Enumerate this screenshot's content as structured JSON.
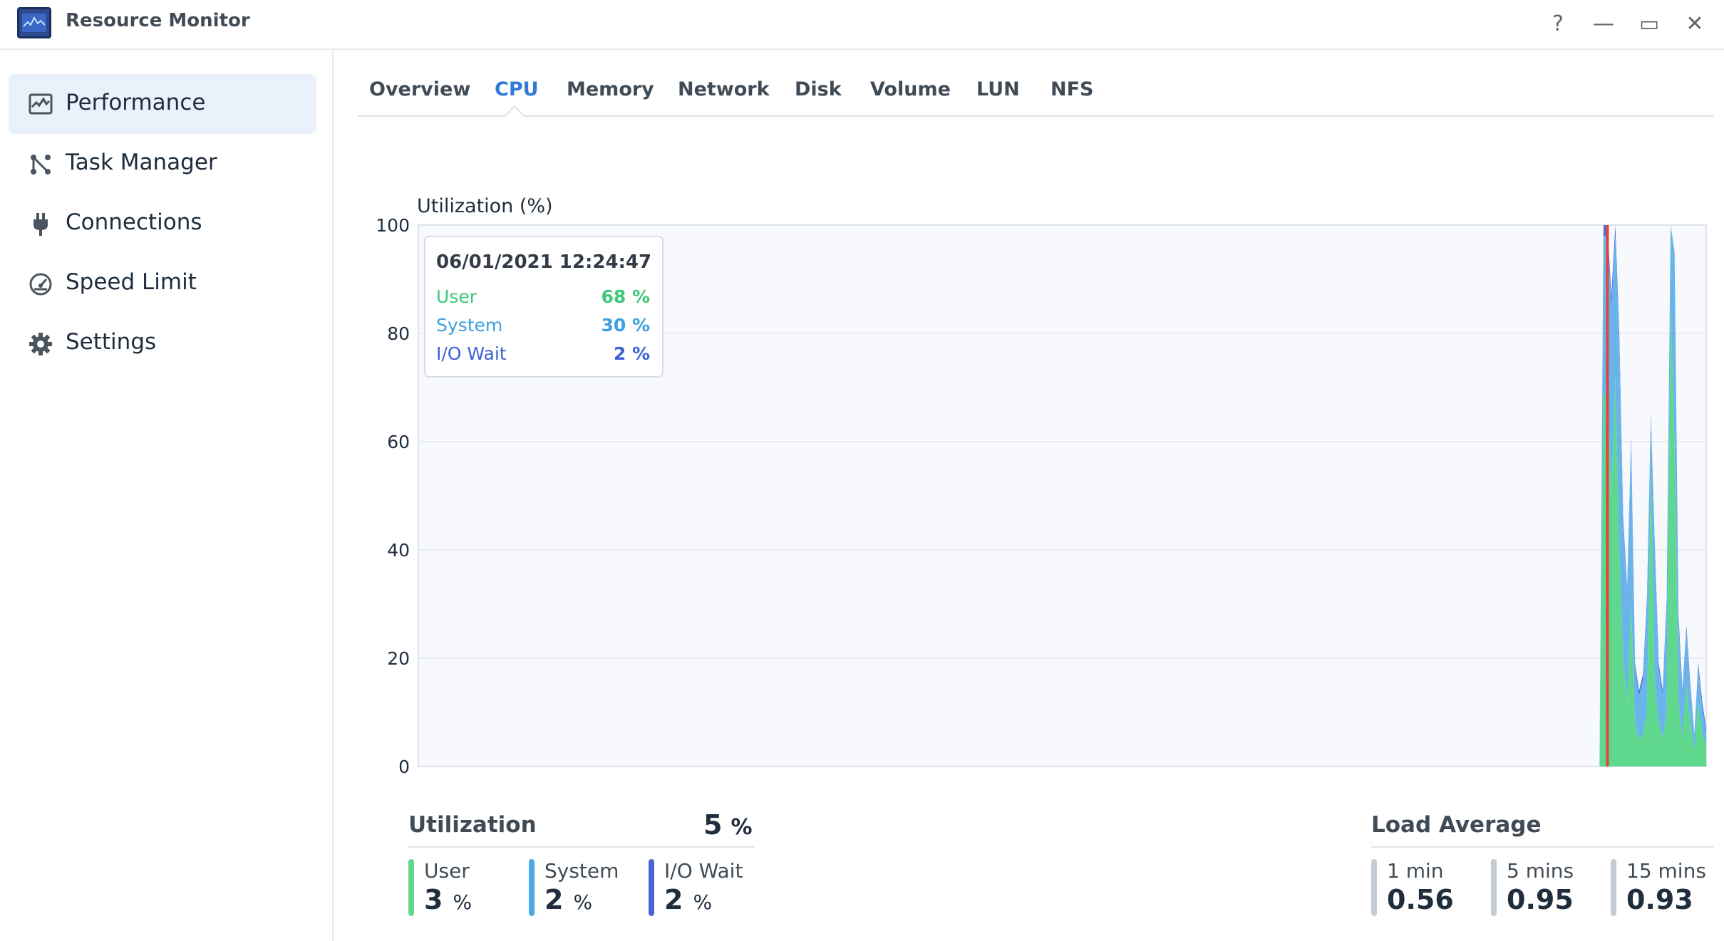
{
  "window": {
    "title": "Resource Monitor",
    "help_label": "?",
    "minimize_label": "—",
    "maximize_label": "▭",
    "close_label": "✕"
  },
  "sidebar": {
    "items": [
      {
        "label": "Performance",
        "icon": "performance-icon",
        "active": true
      },
      {
        "label": "Task Manager",
        "icon": "task-manager-icon",
        "active": false
      },
      {
        "label": "Connections",
        "icon": "plug-icon",
        "active": false
      },
      {
        "label": "Speed Limit",
        "icon": "speedometer-icon",
        "active": false
      },
      {
        "label": "Settings",
        "icon": "gear-icon",
        "active": false
      }
    ]
  },
  "tabs": [
    {
      "label": "Overview",
      "active": false
    },
    {
      "label": "CPU",
      "active": true
    },
    {
      "label": "Memory",
      "active": false
    },
    {
      "label": "Network",
      "active": false
    },
    {
      "label": "Disk",
      "active": false
    },
    {
      "label": "Volume",
      "active": false
    },
    {
      "label": "LUN",
      "active": false
    },
    {
      "label": "NFS",
      "active": false
    }
  ],
  "chart_data": {
    "type": "area",
    "ylabel": "Utilization (%)",
    "ylim": [
      0,
      100
    ],
    "yticks": [
      0,
      20,
      40,
      60,
      80,
      100
    ],
    "grid": true,
    "colors": {
      "user": "#5fd88e",
      "system": "#4fa8e8",
      "iowait": "#3d62d4",
      "cursor": "#e0443c"
    },
    "tooltip": {
      "timestamp": "06/01/2021 12:24:47",
      "rows": [
        {
          "name": "User",
          "value": "68 %",
          "color": "#3fc77a"
        },
        {
          "name": "System",
          "value": "30 %",
          "color": "#3aa0e0"
        },
        {
          "name": "I/O Wait",
          "value": "2 %",
          "color": "#3d62d4"
        }
      ]
    },
    "series": [
      {
        "name": "User",
        "values": [
          0,
          0,
          0,
          0,
          0,
          0,
          0,
          0,
          0,
          0,
          0,
          0,
          0,
          0,
          0,
          0,
          0,
          0,
          0,
          0,
          0,
          0,
          0,
          0,
          0,
          0,
          0,
          0,
          0,
          0,
          0,
          0,
          0,
          0,
          0,
          0,
          0,
          0,
          0,
          0,
          0,
          0,
          0,
          0,
          0,
          0,
          0,
          0,
          0,
          0,
          0,
          0,
          0,
          0,
          0,
          0,
          0,
          0,
          0,
          0,
          0,
          0,
          0,
          0,
          0,
          0,
          0,
          0,
          0,
          0,
          0,
          0,
          0,
          0,
          0,
          0,
          0,
          0,
          0,
          0,
          0,
          0,
          0,
          0,
          0,
          0,
          0,
          0,
          0,
          0,
          0,
          0,
          0,
          0,
          0,
          0,
          0,
          0,
          0,
          0,
          0,
          0,
          0,
          0,
          0,
          0,
          0,
          0,
          0,
          0,
          0,
          0,
          0,
          0,
          0,
          0,
          0,
          0,
          0,
          0,
          0,
          0,
          0,
          0,
          0,
          0,
          0,
          0,
          0,
          0,
          0,
          0,
          0,
          0,
          0,
          0,
          0,
          0,
          0,
          0,
          0,
          0,
          0,
          0,
          0,
          0,
          0,
          0,
          0,
          0,
          0,
          0,
          0,
          0,
          0,
          0,
          0,
          0,
          0,
          0,
          0,
          0,
          0,
          0,
          0,
          0,
          0,
          0,
          0,
          0,
          0,
          0,
          0,
          0,
          0,
          0,
          0,
          0,
          0,
          0,
          0,
          0,
          0,
          0,
          0,
          0,
          0,
          0,
          0,
          0,
          0,
          0,
          0,
          0,
          0,
          0,
          0,
          0,
          0,
          0,
          0,
          0,
          0,
          0,
          0,
          0,
          0,
          0,
          0,
          0,
          0,
          0,
          0,
          0,
          0,
          0,
          0,
          0,
          0,
          0,
          0,
          0,
          0,
          0,
          0,
          0,
          0,
          0,
          0,
          0,
          0,
          0,
          0,
          0,
          0,
          0,
          0,
          0,
          0,
          0,
          0,
          0,
          0,
          0,
          0,
          0,
          0,
          0,
          0,
          0,
          0,
          0,
          0,
          0,
          0,
          0,
          0,
          0,
          0,
          0,
          0,
          0,
          0,
          0,
          0,
          0,
          0,
          0,
          0,
          0,
          0,
          0,
          0,
          0,
          0,
          0,
          0,
          0,
          0,
          0,
          0,
          0,
          0,
          0,
          0,
          0,
          0,
          0,
          0,
          0,
          0,
          0,
          0,
          0,
          0,
          0,
          0,
          0,
          0,
          0,
          68,
          70,
          50,
          72,
          40,
          20,
          12,
          30,
          8,
          5,
          6,
          10,
          55,
          15,
          8,
          5,
          10,
          85,
          60,
          12,
          5,
          15,
          8,
          3,
          12,
          6,
          4
        ]
      },
      {
        "name": "System",
        "values": [
          0,
          0,
          0,
          0,
          0,
          0,
          0,
          0,
          0,
          0,
          0,
          0,
          0,
          0,
          0,
          0,
          0,
          0,
          0,
          0,
          0,
          0,
          0,
          0,
          0,
          0,
          0,
          0,
          0,
          0,
          0,
          0,
          0,
          0,
          0,
          0,
          0,
          0,
          0,
          0,
          0,
          0,
          0,
          0,
          0,
          0,
          0,
          0,
          0,
          0,
          0,
          0,
          0,
          0,
          0,
          0,
          0,
          0,
          0,
          0,
          0,
          0,
          0,
          0,
          0,
          0,
          0,
          0,
          0,
          0,
          0,
          0,
          0,
          0,
          0,
          0,
          0,
          0,
          0,
          0,
          0,
          0,
          0,
          0,
          0,
          0,
          0,
          0,
          0,
          0,
          0,
          0,
          0,
          0,
          0,
          0,
          0,
          0,
          0,
          0,
          0,
          0,
          0,
          0,
          0,
          0,
          0,
          0,
          0,
          0,
          0,
          0,
          0,
          0,
          0,
          0,
          0,
          0,
          0,
          0,
          0,
          0,
          0,
          0,
          0,
          0,
          0,
          0,
          0,
          0,
          0,
          0,
          0,
          0,
          0,
          0,
          0,
          0,
          0,
          0,
          0,
          0,
          0,
          0,
          0,
          0,
          0,
          0,
          0,
          0,
          0,
          0,
          0,
          0,
          0,
          0,
          0,
          0,
          0,
          0,
          0,
          0,
          0,
          0,
          0,
          0,
          0,
          0,
          0,
          0,
          0,
          0,
          0,
          0,
          0,
          0,
          0,
          0,
          0,
          0,
          0,
          0,
          0,
          0,
          0,
          0,
          0,
          0,
          0,
          0,
          0,
          0,
          0,
          0,
          0,
          0,
          0,
          0,
          0,
          0,
          0,
          0,
          0,
          0,
          0,
          0,
          0,
          0,
          0,
          0,
          0,
          0,
          0,
          0,
          0,
          0,
          0,
          0,
          0,
          0,
          0,
          0,
          0,
          0,
          0,
          0,
          0,
          0,
          0,
          0,
          0,
          0,
          0,
          0,
          0,
          0,
          0,
          0,
          0,
          0,
          0,
          0,
          0,
          0,
          0,
          0,
          0,
          0,
          0,
          0,
          0,
          0,
          0,
          0,
          0,
          0,
          0,
          0,
          0,
          0,
          0,
          0,
          0,
          0,
          0,
          0,
          0,
          0,
          0,
          0,
          0,
          0,
          0,
          0,
          0,
          0,
          0,
          0,
          0,
          0,
          0,
          0,
          0,
          0,
          0,
          0,
          0,
          0,
          0,
          0,
          0,
          0,
          0,
          0,
          0,
          0,
          0,
          0,
          0,
          0,
          30,
          28,
          35,
          26,
          38,
          25,
          20,
          30,
          10,
          8,
          10,
          20,
          9,
          25,
          10,
          8,
          20,
          15,
          35,
          15,
          8,
          10,
          6,
          3,
          6,
          5,
          2
        ]
      },
      {
        "name": "I/O Wait",
        "values": [
          0,
          0,
          0,
          0,
          0,
          0,
          0,
          0,
          0,
          0,
          0,
          0,
          0,
          0,
          0,
          0,
          0,
          0,
          0,
          0,
          0,
          0,
          0,
          0,
          0,
          0,
          0,
          0,
          0,
          0,
          0,
          0,
          0,
          0,
          0,
          0,
          0,
          0,
          0,
          0,
          0,
          0,
          0,
          0,
          0,
          0,
          0,
          0,
          0,
          0,
          0,
          0,
          0,
          0,
          0,
          0,
          0,
          0,
          0,
          0,
          0,
          0,
          0,
          0,
          0,
          0,
          0,
          0,
          0,
          0,
          0,
          0,
          0,
          0,
          0,
          0,
          0,
          0,
          0,
          0,
          0,
          0,
          0,
          0,
          0,
          0,
          0,
          0,
          0,
          0,
          0,
          0,
          0,
          0,
          0,
          0,
          0,
          0,
          0,
          0,
          0,
          0,
          0,
          0,
          0,
          0,
          0,
          0,
          0,
          0,
          0,
          0,
          0,
          0,
          0,
          0,
          0,
          0,
          0,
          0,
          0,
          0,
          0,
          0,
          0,
          0,
          0,
          0,
          0,
          0,
          0,
          0,
          0,
          0,
          0,
          0,
          0,
          0,
          0,
          0,
          0,
          0,
          0,
          0,
          0,
          0,
          0,
          0,
          0,
          0,
          0,
          0,
          0,
          0,
          0,
          0,
          0,
          0,
          0,
          0,
          0,
          0,
          0,
          0,
          0,
          0,
          0,
          0,
          0,
          0,
          0,
          0,
          0,
          0,
          0,
          0,
          0,
          0,
          0,
          0,
          0,
          0,
          0,
          0,
          0,
          0,
          0,
          0,
          0,
          0,
          0,
          0,
          0,
          0,
          0,
          0,
          0,
          0,
          0,
          0,
          0,
          0,
          0,
          0,
          0,
          0,
          0,
          0,
          0,
          0,
          0,
          0,
          0,
          0,
          0,
          0,
          0,
          0,
          0,
          0,
          0,
          0,
          0,
          0,
          0,
          0,
          0,
          0,
          0,
          0,
          0,
          0,
          0,
          0,
          0,
          0,
          0,
          0,
          0,
          0,
          0,
          0,
          0,
          0,
          0,
          0,
          0,
          0,
          0,
          0,
          0,
          0,
          0,
          0,
          0,
          0,
          0,
          0,
          0,
          0,
          0,
          0,
          0,
          0,
          0,
          0,
          0,
          0,
          0,
          0,
          0,
          0,
          0,
          0,
          0,
          0,
          0,
          0,
          0,
          0,
          0,
          0,
          0,
          0,
          0,
          0,
          0,
          0,
          0,
          0,
          0,
          0,
          0,
          0,
          0,
          0,
          0,
          0,
          0,
          0,
          2,
          2,
          2,
          2,
          2,
          1,
          1,
          1,
          1,
          1,
          1,
          1,
          1,
          1,
          1,
          1,
          1,
          0,
          0,
          1,
          1,
          1,
          1,
          0,
          1,
          1,
          1
        ]
      }
    ],
    "cursor_index": 301
  },
  "utilization": {
    "title": "Utilization",
    "total": "5",
    "total_unit": "%",
    "stats": [
      {
        "name": "User",
        "value": "3",
        "unit": "%",
        "color": "#5fd88e"
      },
      {
        "name": "System",
        "value": "2",
        "unit": "%",
        "color": "#4fa8e8"
      },
      {
        "name": "I/O Wait",
        "value": "2",
        "unit": "%",
        "color": "#4a66d6"
      }
    ]
  },
  "load_average": {
    "title": "Load Average",
    "stats": [
      {
        "name": "1 min",
        "value": "0.56"
      },
      {
        "name": "5 mins",
        "value": "0.95"
      },
      {
        "name": "15 mins",
        "value": "0.93"
      }
    ],
    "bar_color": "#c4cbd3"
  }
}
